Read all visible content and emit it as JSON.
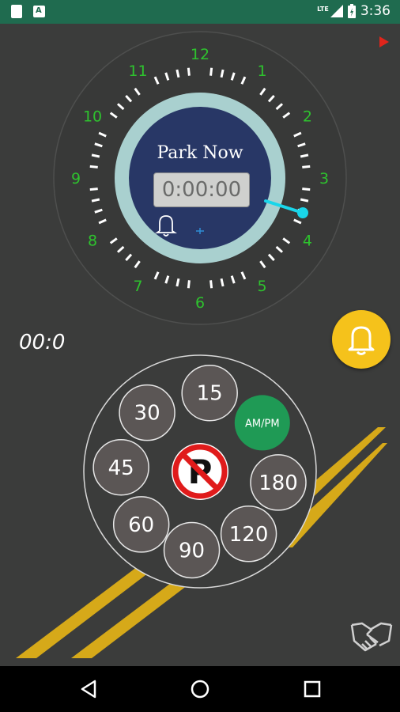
{
  "status_bar": {
    "lte": "LTE",
    "time": "3:36"
  },
  "clock": {
    "title": "Park Now",
    "timer": "0:00:00",
    "hour_labels": [
      "12",
      "1",
      "2",
      "3",
      "4",
      "5",
      "6",
      "7",
      "8",
      "9",
      "10",
      "11"
    ],
    "colors": {
      "hour_label": "#2ec22e",
      "hand": "#19d6ea",
      "ring": "#a9d0cf",
      "face": "#283766"
    }
  },
  "elapsed_time": "00:0",
  "duration_dial": {
    "options": [
      "15",
      "AM/PM",
      "180",
      "120",
      "90",
      "60",
      "45",
      "30"
    ],
    "ampm_color": "#1f9a55",
    "no_parking_icon": "no-parking-sign"
  },
  "icons": {
    "play": "play-icon",
    "alarm_fab": "bell-icon",
    "clock_bell": "bell-outline-icon",
    "handshake": "handshake-icon"
  },
  "nav": {
    "back": "back-icon",
    "home": "home-icon",
    "recents": "recents-icon"
  }
}
